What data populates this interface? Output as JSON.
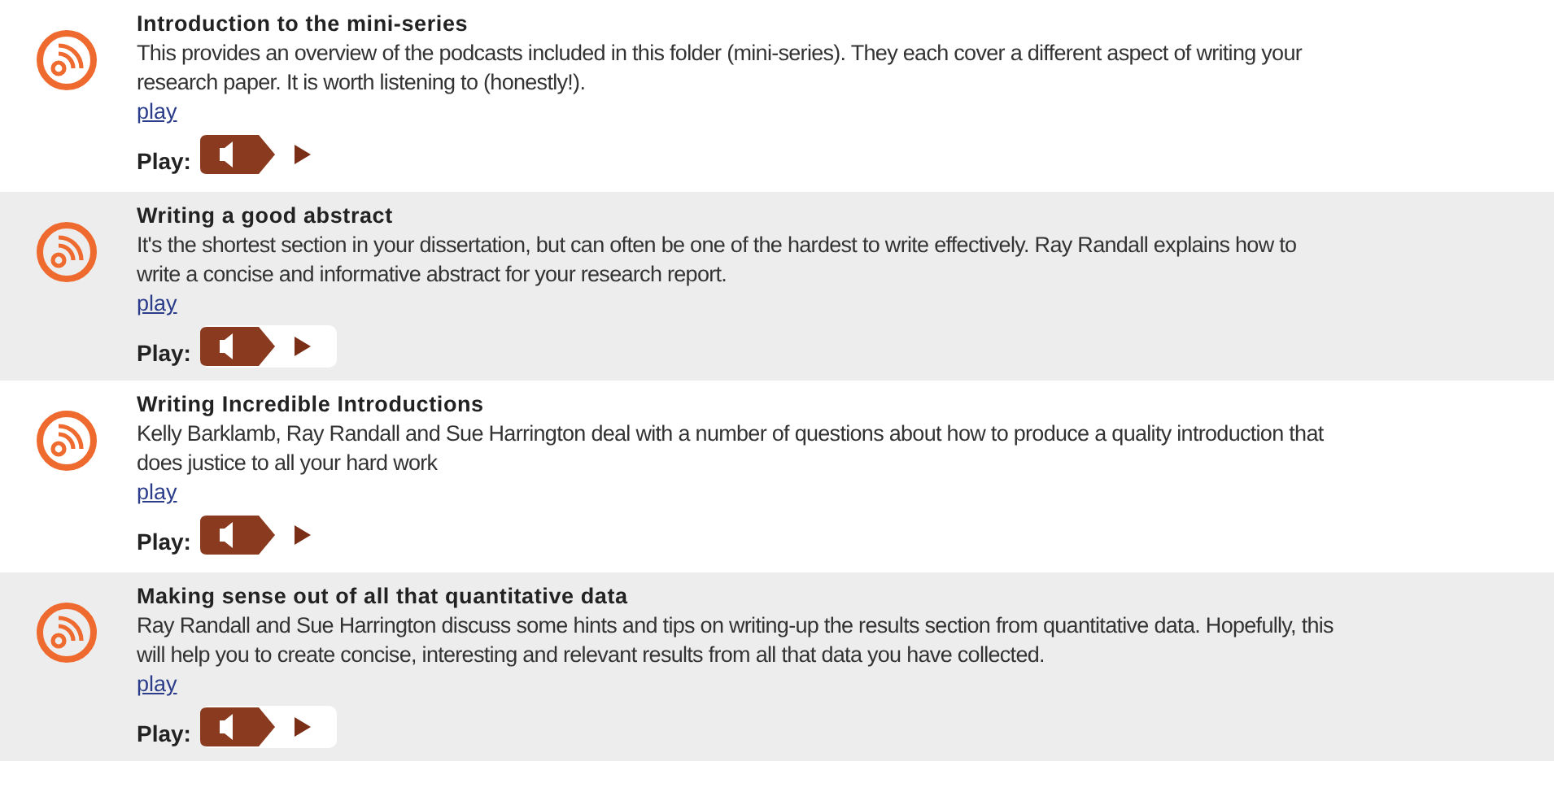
{
  "podcasts": [
    {
      "title": "Introduction to the mini-series",
      "description": "This provides an overview of the podcasts included in this folder (mini-series). They each cover a different aspect of writing your research paper. It is worth listening to (honestly!).",
      "link": "play",
      "player_label": "Play:"
    },
    {
      "title": "Writing a good abstract",
      "description": "It's the shortest section in your dissertation, but can often be one of the hardest to write effectively. Ray Randall explains how to write a concise and informative abstract for your research report.",
      "link": "play",
      "player_label": "Play:"
    },
    {
      "title": "Writing Incredible Introductions",
      "description": "Kelly Barklamb, Ray Randall and Sue Harrington deal with a number of questions about how to produce a quality introduction that does justice to all your hard work",
      "link": "play",
      "player_label": "Play:"
    },
    {
      "title": "Making sense out of all that quantitative data",
      "description": "Ray Randall and Sue Harrington discuss some hints and tips on writing-up the results section from quantitative data. Hopefully, this will help you to create concise, interesting and relevant results from all that data you have collected.",
      "link": "play",
      "player_label": "Play:"
    }
  ]
}
